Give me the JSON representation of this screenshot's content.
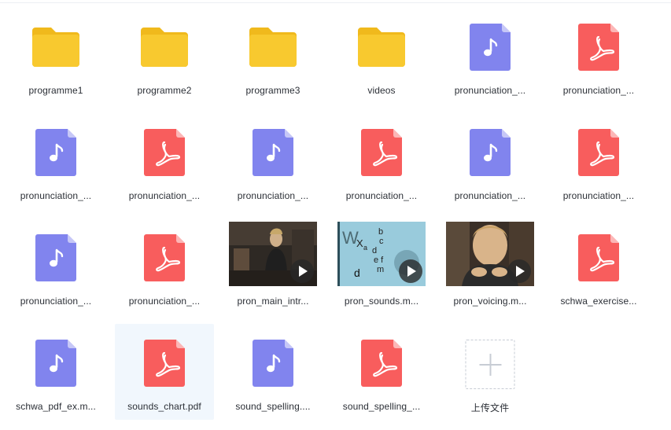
{
  "colors": {
    "folder": "#f8c92f",
    "folder_tab": "#f0b91c",
    "audio": "#8184ee",
    "pdf": "#f85d5d"
  },
  "files": [
    {
      "type": "folder",
      "name": "programme1",
      "icon": "folder-icon"
    },
    {
      "type": "folder",
      "name": "programme2",
      "icon": "folder-icon"
    },
    {
      "type": "folder",
      "name": "programme3",
      "icon": "folder-icon"
    },
    {
      "type": "folder",
      "name": "videos",
      "icon": "folder-icon"
    },
    {
      "type": "audio",
      "name": "pronunciation_...",
      "icon": "music-file-icon"
    },
    {
      "type": "pdf",
      "name": "pronunciation_...",
      "icon": "pdf-file-icon"
    },
    {
      "type": "audio",
      "name": "pronunciation_...",
      "icon": "music-file-icon"
    },
    {
      "type": "pdf",
      "name": "pronunciation_...",
      "icon": "pdf-file-icon"
    },
    {
      "type": "audio",
      "name": "pronunciation_...",
      "icon": "music-file-icon"
    },
    {
      "type": "pdf",
      "name": "pronunciation_...",
      "icon": "pdf-file-icon"
    },
    {
      "type": "audio",
      "name": "pronunciation_...",
      "icon": "music-file-icon"
    },
    {
      "type": "pdf",
      "name": "pronunciation_...",
      "icon": "pdf-file-icon"
    },
    {
      "type": "audio",
      "name": "pronunciation_...",
      "icon": "music-file-icon"
    },
    {
      "type": "pdf",
      "name": "pronunciation_...",
      "icon": "pdf-file-icon"
    },
    {
      "type": "video",
      "name": "pron_main_intr...",
      "icon": "video-thumbnail",
      "scene": "interview"
    },
    {
      "type": "video",
      "name": "pron_sounds.m...",
      "icon": "video-thumbnail",
      "scene": "letters"
    },
    {
      "type": "video",
      "name": "pron_voicing.m...",
      "icon": "video-thumbnail",
      "scene": "closeup"
    },
    {
      "type": "pdf",
      "name": "schwa_exercise...",
      "icon": "pdf-file-icon"
    },
    {
      "type": "audio",
      "name": "schwa_pdf_ex.m...",
      "icon": "music-file-icon"
    },
    {
      "type": "pdf",
      "name": "sounds_chart.pdf",
      "icon": "pdf-file-icon",
      "selected": true
    },
    {
      "type": "audio",
      "name": "sound_spelling....",
      "icon": "music-file-icon"
    },
    {
      "type": "pdf",
      "name": "sound_spelling_...",
      "icon": "pdf-file-icon"
    },
    {
      "type": "upload",
      "name": "上传文件",
      "icon": "plus-icon"
    }
  ]
}
